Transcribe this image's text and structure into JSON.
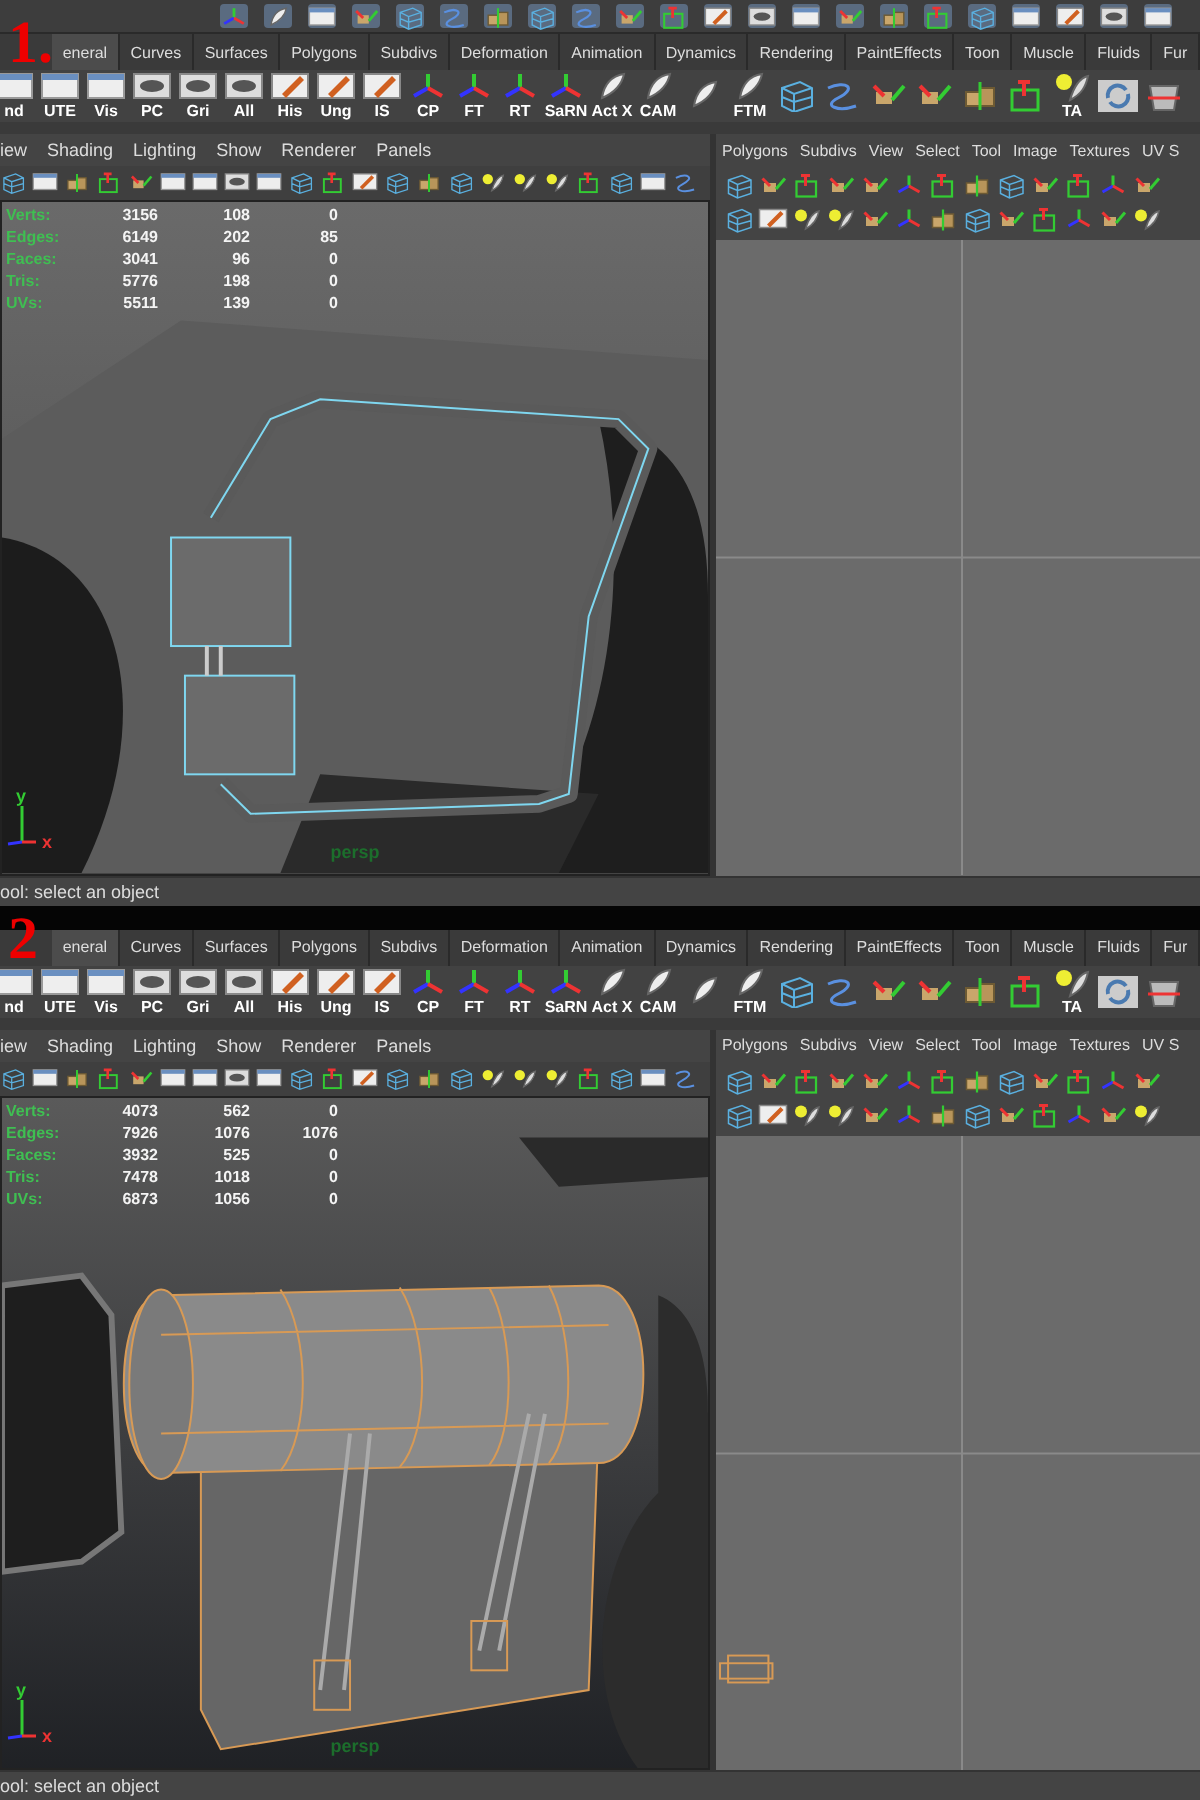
{
  "panels": [
    {
      "step_number": "1.",
      "shelf_tabs": [
        {
          "label": "eneral",
          "selected": true
        },
        {
          "label": "Curves",
          "selected": false
        },
        {
          "label": "Surfaces",
          "selected": false
        },
        {
          "label": "Polygons",
          "selected": false
        },
        {
          "label": "Subdivs",
          "selected": false
        },
        {
          "label": "Deformation",
          "selected": false
        },
        {
          "label": "Animation",
          "selected": false
        },
        {
          "label": "Dynamics",
          "selected": false
        },
        {
          "label": "Rendering",
          "selected": false
        },
        {
          "label": "PaintEffects",
          "selected": false
        },
        {
          "label": "Toon",
          "selected": false
        },
        {
          "label": "Muscle",
          "selected": false
        },
        {
          "label": "Fluids",
          "selected": false
        },
        {
          "label": "Fur",
          "selected": false
        }
      ],
      "shelf_buttons": [
        {
          "kind": "window",
          "label": "nd"
        },
        {
          "kind": "window",
          "label": "UTE"
        },
        {
          "kind": "window",
          "label": "Vis"
        },
        {
          "kind": "eye",
          "label": "PC"
        },
        {
          "kind": "eye",
          "label": "Gri"
        },
        {
          "kind": "eye",
          "label": "All"
        },
        {
          "kind": "pencil",
          "label": "His"
        },
        {
          "kind": "pencil",
          "label": "Ung"
        },
        {
          "kind": "pencil",
          "label": "IS"
        },
        {
          "kind": "axes",
          "label": "CP"
        },
        {
          "kind": "axes",
          "label": "FT"
        },
        {
          "kind": "axes",
          "label": "RT"
        },
        {
          "kind": "axes",
          "label": "SaRN"
        },
        {
          "kind": "feather",
          "label": "Act X"
        },
        {
          "kind": "feather",
          "label": "CAM"
        },
        {
          "kind": "feather"
        },
        {
          "kind": "feather",
          "label": "FTM"
        },
        {
          "kind": "cage"
        },
        {
          "kind": "curve"
        },
        {
          "kind": "move"
        },
        {
          "kind": "move"
        },
        {
          "kind": "boxes"
        },
        {
          "kind": "frame"
        },
        {
          "kind": "bulb",
          "label": "TA"
        },
        {
          "kind": "refresh"
        },
        {
          "kind": "bucket"
        }
      ],
      "viewport": {
        "menus": [
          "iew",
          "Shading",
          "Lighting",
          "Show",
          "Renderer",
          "Panels"
        ],
        "stats": [
          {
            "label": "Verts:",
            "values": [
              "3156",
              "108",
              "0"
            ]
          },
          {
            "label": "Edges:",
            "values": [
              "6149",
              "202",
              "85"
            ]
          },
          {
            "label": "Faces:",
            "values": [
              "3041",
              "96",
              "0"
            ]
          },
          {
            "label": "Tris:",
            "values": [
              "5776",
              "198",
              "0"
            ]
          },
          {
            "label": "UVs:",
            "values": [
              "5511",
              "139",
              "0"
            ]
          }
        ],
        "axis_labels": [
          "y",
          "x"
        ],
        "camera": "persp"
      },
      "uv_editor": {
        "menus": [
          "Polygons",
          "Subdivs",
          "View",
          "Select",
          "Tool",
          "Image",
          "Textures",
          "UV S"
        ]
      },
      "status": "ool: select an object"
    },
    {
      "step_number": "2",
      "shelf_tabs": [
        {
          "label": "eneral",
          "selected": true
        },
        {
          "label": "Curves",
          "selected": false
        },
        {
          "label": "Surfaces",
          "selected": false
        },
        {
          "label": "Polygons",
          "selected": false
        },
        {
          "label": "Subdivs",
          "selected": false
        },
        {
          "label": "Deformation",
          "selected": false
        },
        {
          "label": "Animation",
          "selected": false
        },
        {
          "label": "Dynamics",
          "selected": false
        },
        {
          "label": "Rendering",
          "selected": false
        },
        {
          "label": "PaintEffects",
          "selected": false
        },
        {
          "label": "Toon",
          "selected": false
        },
        {
          "label": "Muscle",
          "selected": false
        },
        {
          "label": "Fluids",
          "selected": false
        },
        {
          "label": "Fur",
          "selected": false
        }
      ],
      "shelf_buttons": [
        {
          "kind": "window",
          "label": "nd"
        },
        {
          "kind": "window",
          "label": "UTE"
        },
        {
          "kind": "window",
          "label": "Vis"
        },
        {
          "kind": "eye",
          "label": "PC"
        },
        {
          "kind": "eye",
          "label": "Gri"
        },
        {
          "kind": "eye",
          "label": "All"
        },
        {
          "kind": "pencil",
          "label": "His"
        },
        {
          "kind": "pencil",
          "label": "Ung"
        },
        {
          "kind": "pencil",
          "label": "IS"
        },
        {
          "kind": "axes",
          "label": "CP"
        },
        {
          "kind": "axes",
          "label": "FT"
        },
        {
          "kind": "axes",
          "label": "RT"
        },
        {
          "kind": "axes",
          "label": "SaRN"
        },
        {
          "kind": "feather",
          "label": "Act X"
        },
        {
          "kind": "feather",
          "label": "CAM"
        },
        {
          "kind": "feather"
        },
        {
          "kind": "feather",
          "label": "FTM"
        },
        {
          "kind": "cage"
        },
        {
          "kind": "curve"
        },
        {
          "kind": "move"
        },
        {
          "kind": "move"
        },
        {
          "kind": "boxes"
        },
        {
          "kind": "frame"
        },
        {
          "kind": "bulb",
          "label": "TA"
        },
        {
          "kind": "refresh"
        },
        {
          "kind": "bucket"
        }
      ],
      "viewport": {
        "menus": [
          "iew",
          "Shading",
          "Lighting",
          "Show",
          "Renderer",
          "Panels"
        ],
        "stats": [
          {
            "label": "Verts:",
            "values": [
              "4073",
              "562",
              "0"
            ]
          },
          {
            "label": "Edges:",
            "values": [
              "7926",
              "1076",
              "1076"
            ]
          },
          {
            "label": "Faces:",
            "values": [
              "3932",
              "525",
              "0"
            ]
          },
          {
            "label": "Tris:",
            "values": [
              "7478",
              "1018",
              "0"
            ]
          },
          {
            "label": "UVs:",
            "values": [
              "6873",
              "1056",
              "0"
            ]
          }
        ],
        "axis_labels": [
          "y",
          "x"
        ],
        "camera": "persp"
      },
      "uv_editor": {
        "menus": [
          "Polygons",
          "Subdivs",
          "View",
          "Select",
          "Tool",
          "Image",
          "Textures",
          "UV S"
        ]
      },
      "status": "ool: select an object"
    }
  ]
}
